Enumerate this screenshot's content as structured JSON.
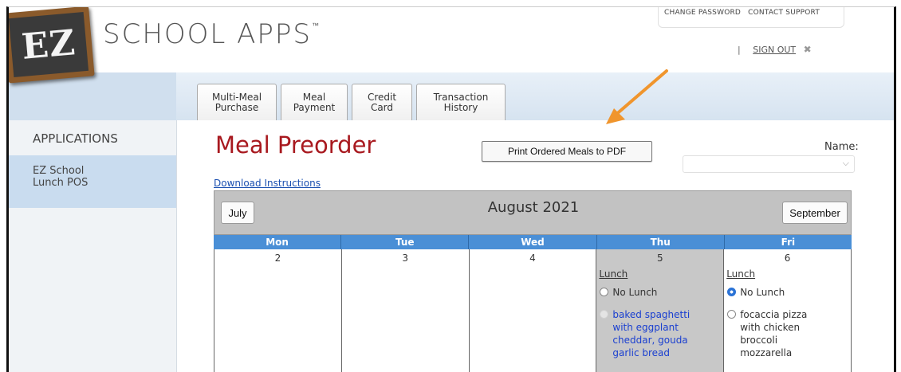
{
  "header": {
    "logo_badge": "EZ",
    "logo_text": "SCHOOL APPS",
    "logo_tm": "™",
    "top_links": [
      "CHANGE PASSWORD",
      "CONTACT SUPPORT"
    ],
    "sign_out_sep": "|",
    "sign_out": "SIGN OUT",
    "sign_out_icon": "close-icon",
    "sign_out_x": "✖"
  },
  "tabs": [
    {
      "label": "Multi-Meal\nPurchase"
    },
    {
      "label": "Meal\nPayment"
    },
    {
      "label": "Credit\nCard"
    },
    {
      "label": "Transaction\nHistory"
    }
  ],
  "sidebar": {
    "title": "APPLICATIONS",
    "items": [
      {
        "label": "EZ School\nLunch POS"
      }
    ]
  },
  "main": {
    "title": "Meal Preorder",
    "print_button": "Print Ordered Meals to PDF",
    "name_label": "Name:",
    "name_value": "",
    "download_link": "Download Instructions"
  },
  "calendar": {
    "month": "August 2021",
    "prev_button": "July",
    "next_button": "September",
    "day_headers": [
      "Mon",
      "Tue",
      "Wed",
      "Thu",
      "Fri"
    ],
    "week": [
      {
        "day": "2"
      },
      {
        "day": "3"
      },
      {
        "day": "4"
      },
      {
        "day": "5",
        "meal_label": "Lunch",
        "options": [
          {
            "text": "No Lunch",
            "state": "unchecked"
          },
          {
            "text": "baked spaghetti\nwith eggplant\ncheddar, gouda\ngarlic bread",
            "state": "disabled"
          }
        ]
      },
      {
        "day": "6",
        "meal_label": "Lunch",
        "options": [
          {
            "text": "No Lunch",
            "state": "checked"
          },
          {
            "text": "focaccia pizza\nwith chicken\nbroccoli\nmozzarella",
            "state": "unchecked"
          }
        ]
      }
    ]
  },
  "colors": {
    "title_red": "#a8191f",
    "header_blue": "#4a8fd6",
    "arrow_orange": "#f0952d",
    "sidebar_active": "#c9dcef"
  }
}
